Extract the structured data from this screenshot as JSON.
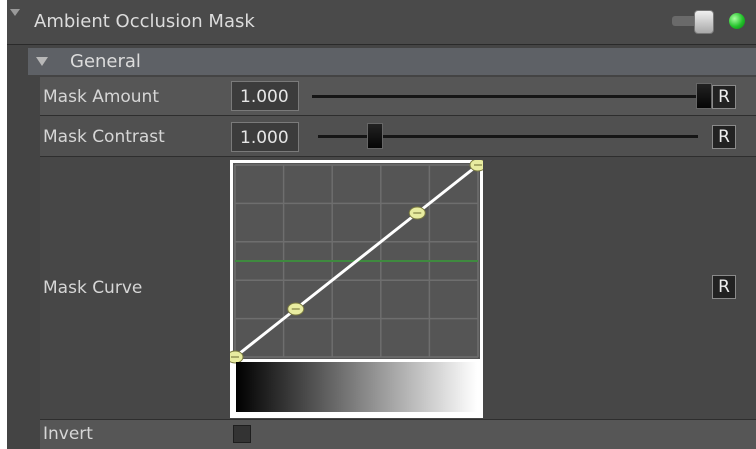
{
  "panel": {
    "title": "Ambient Occlusion Mask",
    "enabled": true,
    "status_color": "#22c22a"
  },
  "group": {
    "title": "General",
    "expanded": true
  },
  "params": {
    "mask_amount": {
      "label": "Mask Amount",
      "value": "1.000",
      "slider_fraction": 1.0,
      "reset_label": "R"
    },
    "mask_contrast": {
      "label": "Mask Contrast",
      "value": "1.000",
      "slider_fraction": 0.05,
      "reset_label": "R"
    },
    "mask_curve": {
      "label": "Mask Curve",
      "reset_label": "R",
      "points": [
        [
          0.0,
          0.0
        ],
        [
          0.25,
          0.25
        ],
        [
          0.75,
          0.75
        ],
        [
          1.0,
          1.0
        ]
      ],
      "reference_level": 0.5,
      "curve_color": "#ffffff",
      "point_color": "#e8eca0",
      "reference_color": "#3f8a3f"
    },
    "invert": {
      "label": "Invert",
      "checked": false
    }
  }
}
